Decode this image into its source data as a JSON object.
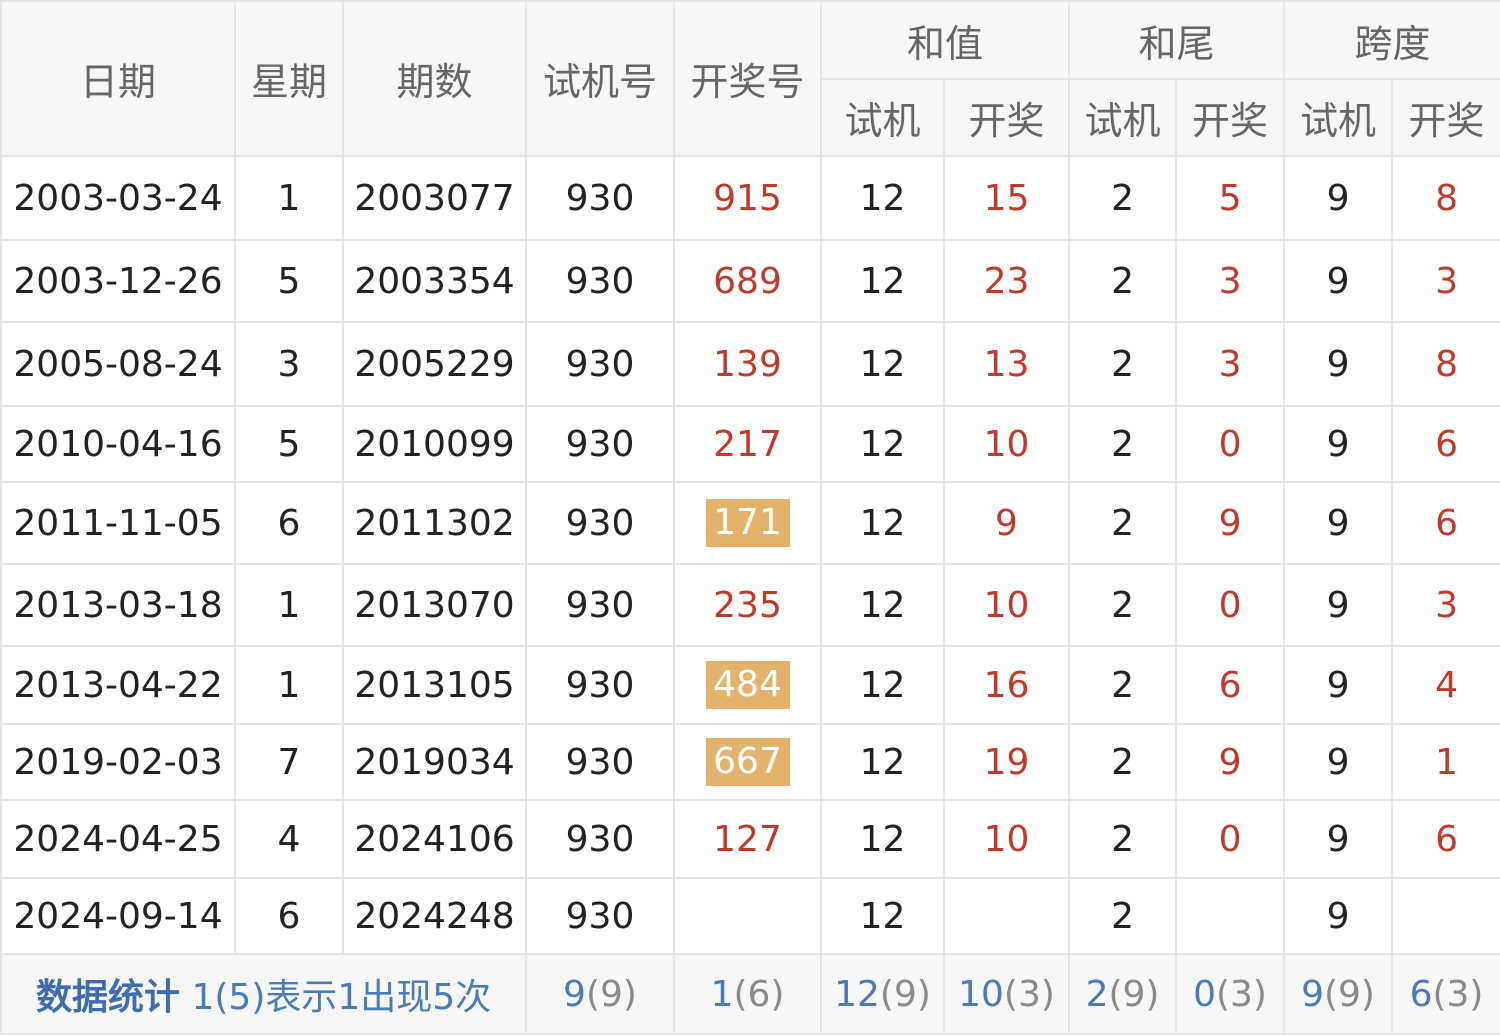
{
  "headers": {
    "date": "日期",
    "weekday": "星期",
    "issue": "期数",
    "trial_number": "试机号",
    "draw_number": "开奖号",
    "sum_group": "和值",
    "tail_group": "和尾",
    "span_group": "跨度",
    "sub_trial": "试机",
    "sub_draw": "开奖"
  },
  "rows": [
    {
      "date": "2003-03-24",
      "weekday": "1",
      "issue": "2003077",
      "trial": "930",
      "draw": "915",
      "draw_highlight": false,
      "sum_trial": "12",
      "sum_draw": "15",
      "tail_trial": "2",
      "tail_draw": "5",
      "span_trial": "9",
      "span_draw": "8"
    },
    {
      "date": "2003-12-26",
      "weekday": "5",
      "issue": "2003354",
      "trial": "930",
      "draw": "689",
      "draw_highlight": false,
      "sum_trial": "12",
      "sum_draw": "23",
      "tail_trial": "2",
      "tail_draw": "3",
      "span_trial": "9",
      "span_draw": "3"
    },
    {
      "date": "2005-08-24",
      "weekday": "3",
      "issue": "2005229",
      "trial": "930",
      "draw": "139",
      "draw_highlight": false,
      "sum_trial": "12",
      "sum_draw": "13",
      "tail_trial": "2",
      "tail_draw": "3",
      "span_trial": "9",
      "span_draw": "8"
    },
    {
      "date": "2010-04-16",
      "weekday": "5",
      "issue": "2010099",
      "trial": "930",
      "draw": "217",
      "draw_highlight": false,
      "sum_trial": "12",
      "sum_draw": "10",
      "tail_trial": "2",
      "tail_draw": "0",
      "span_trial": "9",
      "span_draw": "6"
    },
    {
      "date": "2011-11-05",
      "weekday": "6",
      "issue": "2011302",
      "trial": "930",
      "draw": "171",
      "draw_highlight": true,
      "sum_trial": "12",
      "sum_draw": "9",
      "tail_trial": "2",
      "tail_draw": "9",
      "span_trial": "9",
      "span_draw": "6"
    },
    {
      "date": "2013-03-18",
      "weekday": "1",
      "issue": "2013070",
      "trial": "930",
      "draw": "235",
      "draw_highlight": false,
      "sum_trial": "12",
      "sum_draw": "10",
      "tail_trial": "2",
      "tail_draw": "0",
      "span_trial": "9",
      "span_draw": "3"
    },
    {
      "date": "2013-04-22",
      "weekday": "1",
      "issue": "2013105",
      "trial": "930",
      "draw": "484",
      "draw_highlight": true,
      "sum_trial": "12",
      "sum_draw": "16",
      "tail_trial": "2",
      "tail_draw": "6",
      "span_trial": "9",
      "span_draw": "4"
    },
    {
      "date": "2019-02-03",
      "weekday": "7",
      "issue": "2019034",
      "trial": "930",
      "draw": "667",
      "draw_highlight": true,
      "sum_trial": "12",
      "sum_draw": "19",
      "tail_trial": "2",
      "tail_draw": "9",
      "span_trial": "9",
      "span_draw": "1"
    },
    {
      "date": "2024-04-25",
      "weekday": "4",
      "issue": "2024106",
      "trial": "930",
      "draw": "127",
      "draw_highlight": false,
      "sum_trial": "12",
      "sum_draw": "10",
      "tail_trial": "2",
      "tail_draw": "0",
      "span_trial": "9",
      "span_draw": "6"
    },
    {
      "date": "2024-09-14",
      "weekday": "6",
      "issue": "2024248",
      "trial": "930",
      "draw": "",
      "draw_highlight": false,
      "sum_trial": "12",
      "sum_draw": "",
      "tail_trial": "2",
      "tail_draw": "",
      "span_trial": "9",
      "span_draw": ""
    }
  ],
  "footer": {
    "label": "数据统计",
    "note": "1(5)表示1出现5次",
    "stats": [
      {
        "value": "9",
        "count": "(9)"
      },
      {
        "value": "1",
        "count": "(6)"
      },
      {
        "value": "12",
        "count": "(9)"
      },
      {
        "value": "10",
        "count": "(3)"
      },
      {
        "value": "2",
        "count": "(9)"
      },
      {
        "value": "0",
        "count": "(3)"
      },
      {
        "value": "9",
        "count": "(9)"
      },
      {
        "value": "6",
        "count": "(3)"
      }
    ]
  },
  "colors": {
    "draw_text": "#c0392b",
    "highlight_badge": "#e3b36b",
    "stat_text": "#4a7ab8",
    "header_bg": "#f7f7f7",
    "grid_line": "#e6e6e6"
  }
}
